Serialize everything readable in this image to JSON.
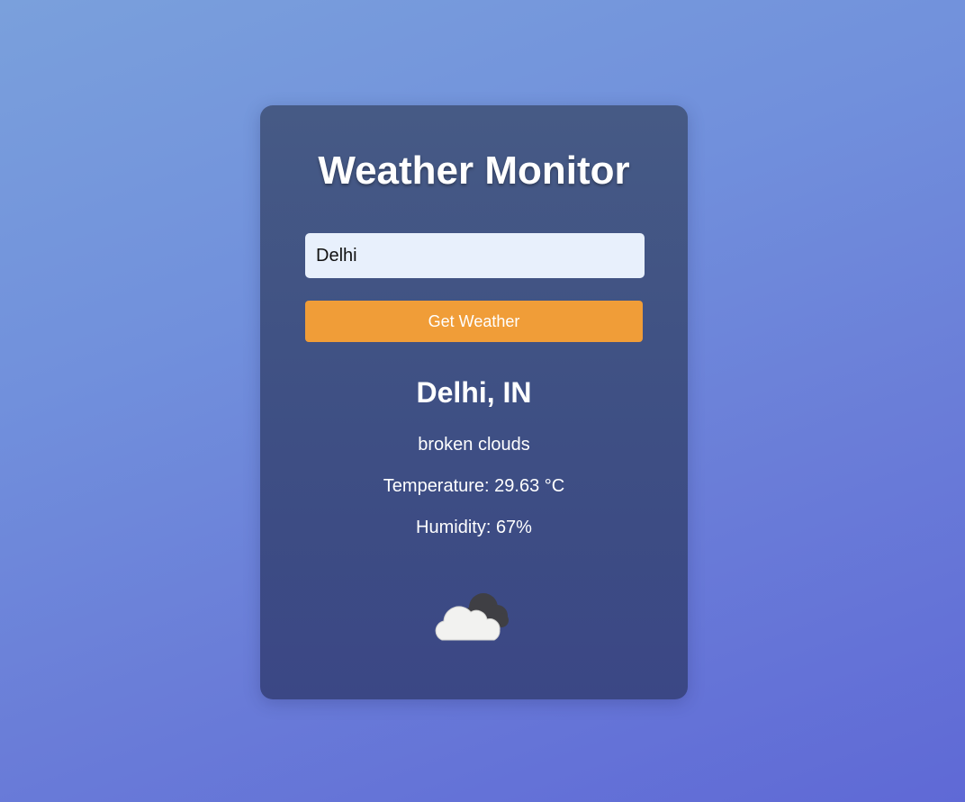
{
  "app": {
    "title": "Weather Monitor"
  },
  "search": {
    "value": "Delhi",
    "button_label": "Get Weather"
  },
  "result": {
    "location": "Delhi, IN",
    "description": "broken clouds",
    "temperature": "Temperature: 29.63 °C",
    "humidity": "Humidity: 67%",
    "icon": "broken-clouds-icon"
  },
  "colors": {
    "accent": "#f09d38",
    "card": "#3e4f84",
    "input_bg": "#e8f0fc"
  }
}
